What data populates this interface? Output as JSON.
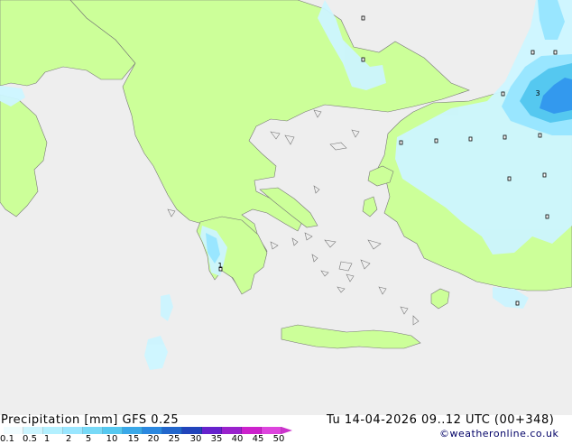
{
  "map": {
    "colors": {
      "sea": "#eeeeee",
      "land": "#ccff99",
      "coast": "#777777",
      "precip_light": "#ccf5ff",
      "precip_low": "#99e6ff",
      "precip_mid": "#55c8f0",
      "precip_high": "#3399ee"
    },
    "point_labels": [
      {
        "text": "1"
      },
      {
        "text": "3"
      }
    ]
  },
  "footer": {
    "title": "Precipitation [mm] GFS 0.25",
    "datetime": "Tu 14-04-2026 09..12 UTC (00+348)",
    "credit": "©weatheronline.co.uk"
  },
  "legend": {
    "ticks": [
      "0.1",
      "0.5",
      "1",
      "2",
      "5",
      "10",
      "15",
      "20",
      "25",
      "30",
      "35",
      "40",
      "45",
      "50"
    ],
    "colors": [
      "#f0fcff",
      "#ccf5ff",
      "#b3f0ff",
      "#99e6ff",
      "#77d9f7",
      "#55c8f0",
      "#3aa8e8",
      "#2b88e0",
      "#2266cc",
      "#2244bb",
      "#6622cc",
      "#9922cc",
      "#cc22cc",
      "#dd44dd"
    ]
  }
}
